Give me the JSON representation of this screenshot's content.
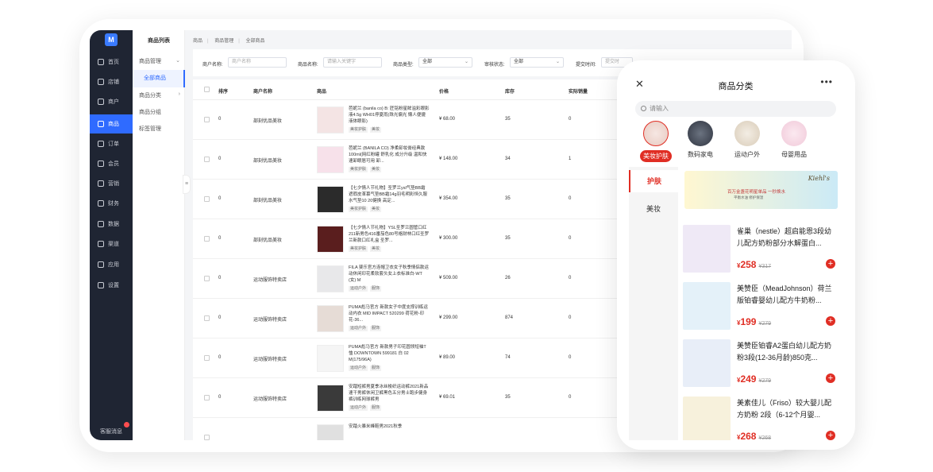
{
  "admin": {
    "logo": "M",
    "nav": [
      {
        "label": "首页",
        "icon": "home-icon"
      },
      {
        "label": "店铺",
        "icon": "store-icon"
      },
      {
        "label": "商户",
        "icon": "merchant-icon"
      },
      {
        "label": "商品",
        "icon": "product-icon"
      },
      {
        "label": "订单",
        "icon": "order-icon"
      },
      {
        "label": "会员",
        "icon": "member-icon"
      },
      {
        "label": "营销",
        "icon": "marketing-icon"
      },
      {
        "label": "财务",
        "icon": "finance-icon"
      },
      {
        "label": "数据",
        "icon": "data-icon"
      },
      {
        "label": "渠道",
        "icon": "channel-icon"
      },
      {
        "label": "应用",
        "icon": "apps-icon"
      },
      {
        "label": "设置",
        "icon": "settings-icon"
      }
    ],
    "kefu": "客服消息",
    "subnav": {
      "title": "商品列表",
      "items": [
        "商品管理",
        "全部商品",
        "商品分类",
        "商品分组",
        "标签管理"
      ]
    },
    "breadcrumb": [
      "商品",
      "商品管理",
      "全部商品"
    ],
    "filters": [
      {
        "label": "商户名称:",
        "placeholder": "商户名称"
      },
      {
        "label": "商品名称:",
        "placeholder": "请输入关键字"
      },
      {
        "label": "商品类型:",
        "value": "全部"
      },
      {
        "label": "审核状态:",
        "value": "全部"
      },
      {
        "label": "提交时间:",
        "value": "提交时"
      }
    ],
    "columns": [
      "排序",
      "商户名称",
      "商品",
      "价格",
      "库存",
      "实际销量"
    ],
    "rows": [
      {
        "sort": "0",
        "merchant": "部刻优品美妆",
        "name": "芭妮兰 (banila co) B: 匠铭粉星眸溢彩眼影液4.5g WH01停夏雨(珠光偏光 懒人便捷 液体眼影)",
        "tags": [
          "美妆护肤",
          "美妆"
        ],
        "price": "¥ 68.00",
        "stock": "35",
        "sales": "0"
      },
      {
        "sort": "0",
        "merchant": "部刻优品美妆",
        "name": "芭妮兰 (BANILA CO) 净柔卸妆膏经典款100ml(网红粉罐 舒乳化 成分升级 温和快速卸眼唇可用 卸...",
        "tags": [
          "美妆护肤",
          "美妆"
        ],
        "price": "¥ 148.00",
        "stock": "34",
        "sales": "1"
      },
      {
        "sort": "0",
        "merchant": "部刻优品美妆",
        "name": "【七夕情人节礼物】圣罗兰ysl气垫BB霜遮瑕皮革慕气垫BB霜14g羽毛明彩恒久服水气垫10 20健换 高定...",
        "tags": [
          "美妆护肤",
          "美妆"
        ],
        "price": "¥ 354.00",
        "stock": "35",
        "sales": "0"
      },
      {
        "sort": "0",
        "merchant": "部刻优品美妆",
        "name": "【七夕情人节礼物】YSL圣罗兰圆管口红211新男色416番茄色80号格财林口红圣罗兰新款口红礼盒 圣罗...",
        "tags": [
          "美妆护肤",
          "美妆"
        ],
        "price": "¥ 300.00",
        "stock": "35",
        "sales": "0"
      },
      {
        "sort": "0",
        "merchant": "运动服饰特卖店",
        "name": "FILA 斐乐官方连帽卫衣女子秋季情侣款运动休闲印花柔软套头女上衣标准白-WT (女) M",
        "tags": [
          "运动户外",
          "服饰"
        ],
        "price": "¥ 509.00",
        "stock": "26",
        "sales": "0"
      },
      {
        "sort": "0",
        "merchant": "运动服饰特卖店",
        "name": "PUMA彪马官方 新款女子中度支撑训练运动内衣 MID IMPACT 520299 荷花粉-印花-36...",
        "tags": [
          "运动户外",
          "服饰"
        ],
        "price": "¥ 299.00",
        "stock": "874",
        "sales": "0"
      },
      {
        "sort": "0",
        "merchant": "运动服饰特卖店",
        "name": "PUMA彪马官方 新款男子印花圆领短袖T恤 DOWNTOWN 599181 白 02 M(175/96A)",
        "tags": [
          "运动户外",
          "服饰"
        ],
        "price": "¥ 89.00",
        "stock": "74",
        "sales": "0"
      },
      {
        "sort": "0",
        "merchant": "运动服饰特卖店",
        "name": "安踏短裤男夏季冰丝梭织运动裤2021新品速干男裤休闲卫裤黑色五分男士跑步健身裤训练网球裤男",
        "tags": [
          "运动户外",
          "服饰"
        ],
        "price": "¥ 69.01",
        "stock": "35",
        "sales": "0"
      },
      {
        "sort": "",
        "merchant": "",
        "name": "安踏火暴米峰鞋男2021秋季",
        "tags": [],
        "price": "",
        "stock": "",
        "sales": ""
      }
    ]
  },
  "mobile": {
    "title": "商品分类",
    "search_placeholder": "请输入",
    "categories": [
      "美妆护肤",
      "数码家电",
      "运动户外",
      "母婴用品"
    ],
    "left_tabs": [
      "护肤",
      "美妆"
    ],
    "banner": {
      "brand": "Kiehl's",
      "line1": "百万金盏花明星单品 一秒焕水",
      "line2": "平衡水油 修护保湿"
    },
    "products": [
      {
        "name": "雀巢（nestle）超启能恩3段幼儿配方奶粉部分水解蛋白...",
        "price": "258",
        "original": "317"
      },
      {
        "name": "美赞臣（MeadJohnson）荷兰版铂睿婴幼儿配方牛奶粉...",
        "price": "199",
        "original": "279"
      },
      {
        "name": "美赞臣铂睿A2蛋白幼儿配方奶粉3段(12-36月龄)850克...",
        "price": "249",
        "original": "279"
      },
      {
        "name": "美素佳儿（Friso）较大婴儿配方奶粉 2段（6-12个月婴...",
        "price": "268",
        "original": "268"
      }
    ],
    "currency": "¥",
    "add_symbol": "+"
  }
}
